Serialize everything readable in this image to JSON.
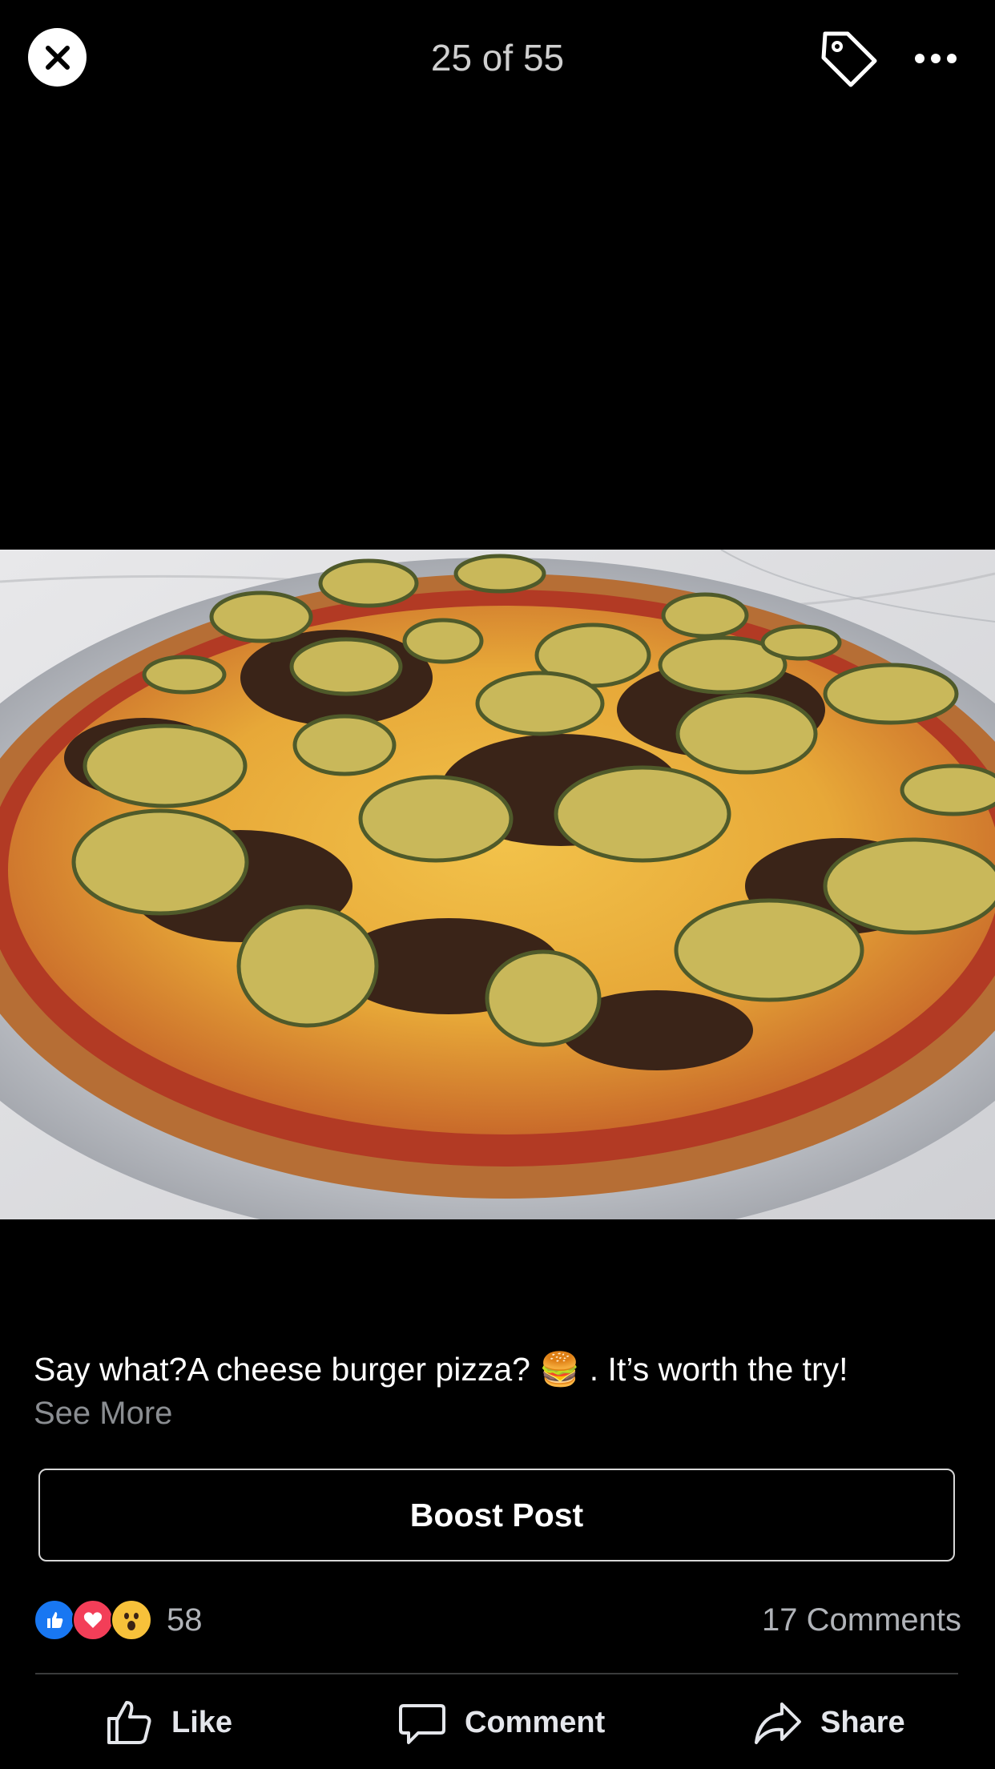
{
  "viewer": {
    "counter": "25 of 55",
    "icons": {
      "close": "close-icon",
      "tag": "tag-icon",
      "more": "more-icon"
    }
  },
  "photo": {
    "icon": "pizza-photo"
  },
  "post": {
    "caption": "Say what?A cheese burger pizza? 🍔 . It’s worth the try!",
    "see_more": "See More"
  },
  "boost": {
    "label": "Boost Post"
  },
  "stats": {
    "reaction_count": "58",
    "comments": "17 Comments",
    "reactions": [
      "like",
      "love",
      "wow"
    ]
  },
  "actions": {
    "like": "Like",
    "comment": "Comment",
    "share": "Share"
  },
  "colors": {
    "background": "#000000",
    "muted_text": "#b0b3b8",
    "like_blue": "#1877f2",
    "love_red": "#f33e58",
    "wow_yellow": "#f7c13a"
  }
}
